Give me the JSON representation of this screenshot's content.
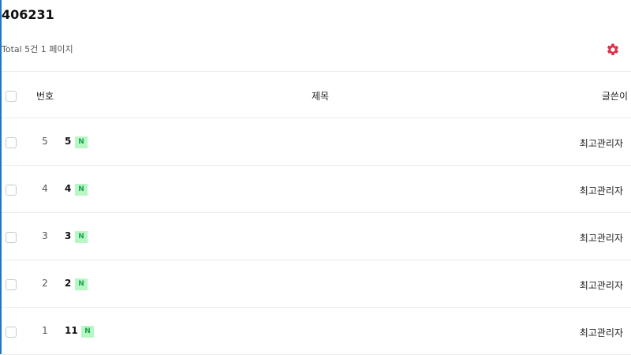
{
  "board": {
    "title": "406231",
    "total_text": "Total 5건 1 페이지"
  },
  "toolbar": {
    "settings_icon": "gear-icon",
    "settings_color": "#e0314a"
  },
  "table": {
    "columns": [
      "번호",
      "제목",
      "글쓴이"
    ],
    "rows": [
      {
        "num": "5",
        "subject": "5",
        "badge": "N",
        "author": "최고관리자"
      },
      {
        "num": "4",
        "subject": "4",
        "badge": "N",
        "author": "최고관리자"
      },
      {
        "num": "3",
        "subject": "3",
        "badge": "N",
        "author": "최고관리자"
      },
      {
        "num": "2",
        "subject": "2",
        "badge": "N",
        "author": "최고관리자"
      },
      {
        "num": "1",
        "subject": "11",
        "badge": "N",
        "author": "최고관리자"
      }
    ]
  },
  "colors": {
    "accent_edge": "#1d76c9",
    "badge_bg": "#b7f7c6",
    "badge_text": "#1ea04e"
  }
}
